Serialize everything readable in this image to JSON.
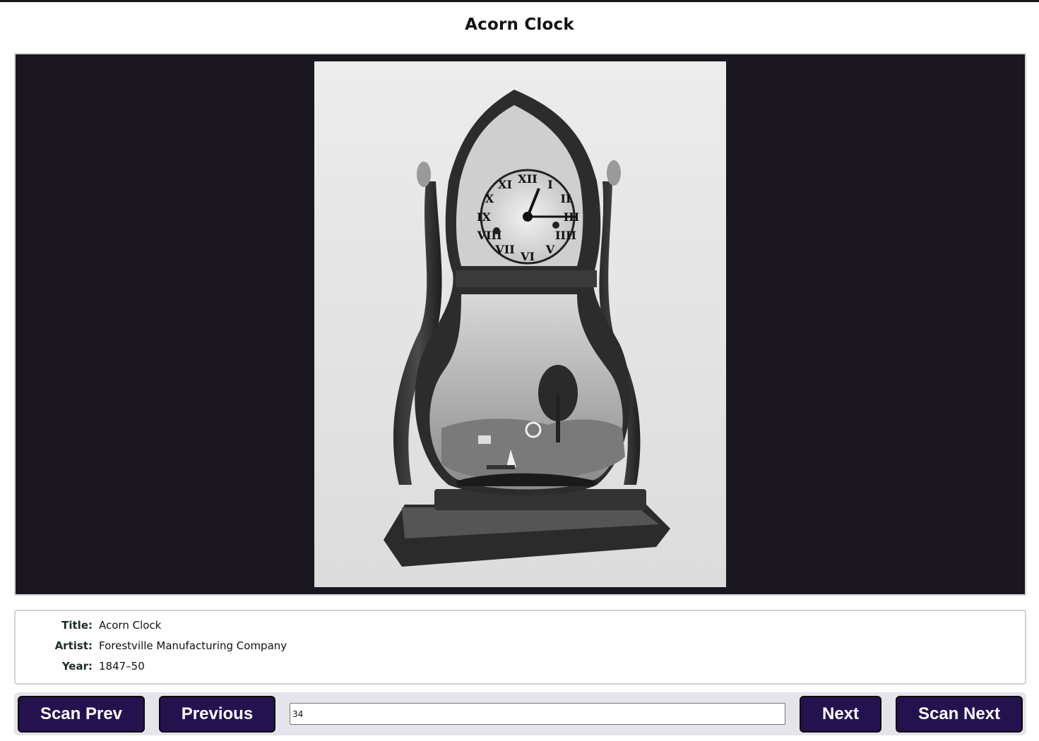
{
  "page": {
    "title": "Acorn Clock"
  },
  "artwork": {
    "alt": "Acorn Clock"
  },
  "info": {
    "title_label": "Title:",
    "title_value": "Acorn Clock",
    "artist_label": "Artist:",
    "artist_value": "Forestville Manufacturing Company",
    "year_label": "Year:",
    "year_value": "1847–50"
  },
  "nav": {
    "scan_prev_label": "Scan Prev",
    "previous_label": "Previous",
    "index_value": "34",
    "next_label": "Next",
    "scan_next_label": "Scan Next"
  },
  "colors": {
    "image_background": "#1b1720",
    "button_background": "#24124f",
    "nav_background": "#e4e4ea"
  },
  "icons": {
    "artwork_image": "acorn-clock-photo"
  }
}
